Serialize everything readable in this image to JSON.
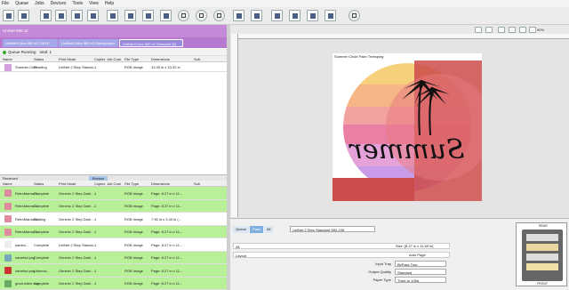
{
  "menu": [
    "File",
    "Queue",
    "Jobs",
    "Devices",
    "Tools",
    "View",
    "Help"
  ],
  "queue_title": "UniNet 560 x2",
  "tabs": [
    "UniNet iColor 560 x2 CMYK",
    "UniNet iColor 560 x2 Oversprayer",
    "UniNet iColor 560 x2 Overprint [1]"
  ],
  "queue_status": {
    "label": "Queue Running",
    "total": "total: 1"
  },
  "columns": [
    "Name",
    "Status",
    "Print Mode",
    "Copies",
    "Job Cost",
    "File Type",
    "Dimensions",
    "Sub"
  ],
  "active_jobs": [
    {
      "name": "Summer Circl...",
      "status": "Pending",
      "mode": "UniNet 2 Step Standa...",
      "copies": "1",
      "type": "RGB Image",
      "dims": "13.35 in x 13.32 in",
      "color": "#d4a0e0"
    }
  ],
  "lower_tabs": [
    "Received",
    "Browse"
  ],
  "lower_columns": [
    "Name",
    "Status",
    "Print Mode",
    "Copies",
    "Job Cost",
    "File Type",
    "Dimensions",
    "Sub"
  ],
  "history": [
    {
      "name": "RetroMamaGi...",
      "status": "Complete",
      "mode": "Generic 2 Step Dark ...",
      "copies": "1",
      "type": "RGB Image",
      "dims": "Page: 8.27 in x 11...",
      "green": true,
      "thumb": "#e08aa0"
    },
    {
      "name": "RetroMamaGi...",
      "status": "Complete",
      "mode": "Generic 2 Step Dark ...",
      "copies": "1",
      "type": "RGB Image",
      "dims": "Page: 8.27 in x 11...",
      "green": true,
      "thumb": "#e08aa0"
    },
    {
      "name": "RetroMamaGi...",
      "status": "Waiting",
      "mode": "Generic 2 Step Dark ...",
      "copies": "1",
      "type": "RGB Image",
      "dims": "7.90 in x 3.43 in (...",
      "green": false,
      "thumb": "#e08aa0"
    },
    {
      "name": "RetroMamaGi...",
      "status": "Complete",
      "mode": "Generic 2 Step Dark ...",
      "copies": "1",
      "type": "RGB Image",
      "dims": "Page: 8.27 in x 11...",
      "green": true,
      "thumb": "#e08aa0"
    },
    {
      "name": "sambo...",
      "status": "Complete",
      "mode": "UniNet 2 Step Standa...",
      "copies": "1",
      "type": "RGB Image",
      "dims": "Page: 8.27 in x 11...",
      "green": false,
      "thumb": "#eeeeee"
    },
    {
      "name": "rainefod.png",
      "status": "Complete",
      "mode": "Generic 2 Step Dark ...",
      "copies": "1",
      "type": "RGB Image",
      "dims": "Page: 8.27 in x 11...",
      "green": true,
      "thumb": "#7ab"
    },
    {
      "name": "rainefod.png",
      "status": "Unknow...",
      "mode": "Generic 2 Step Dark ...",
      "copies": "1",
      "type": "RGB Image",
      "dims": "Page: 8.27 in x 11...",
      "green": true,
      "thumb": "#c33"
    },
    {
      "name": "good.witee.svg",
      "status": "Complete",
      "mode": "Generic 2 Step Dark ...",
      "copies": "1",
      "type": "RGB Image",
      "dims": "Page: 8.27 in x 11...",
      "green": true,
      "thumb": "#6a6"
    }
  ],
  "zoom": "90%",
  "artwork_title": "Summer Circle Palm Treesping",
  "artwork_word": "Summer",
  "bottom_tabs": [
    "Queue",
    "Pass",
    "All"
  ],
  "print_mode": "UniNet 2 Step Standard 560-156",
  "settings": {
    "all_label": "All",
    "size": "Size: [8.27 in x 11.69 in]",
    "layout_label": "Layout",
    "layout": "Auto Page",
    "input_tray_label": "Input Tray",
    "input_tray": "ByPass Tray",
    "output_quality_label": "Output Quality",
    "output_quality": "Standard",
    "paper_type_label": "Paper Type",
    "paper_type": "Thick to 105g"
  },
  "printer_labels": {
    "rear": "REAR",
    "front": "FRONT"
  }
}
